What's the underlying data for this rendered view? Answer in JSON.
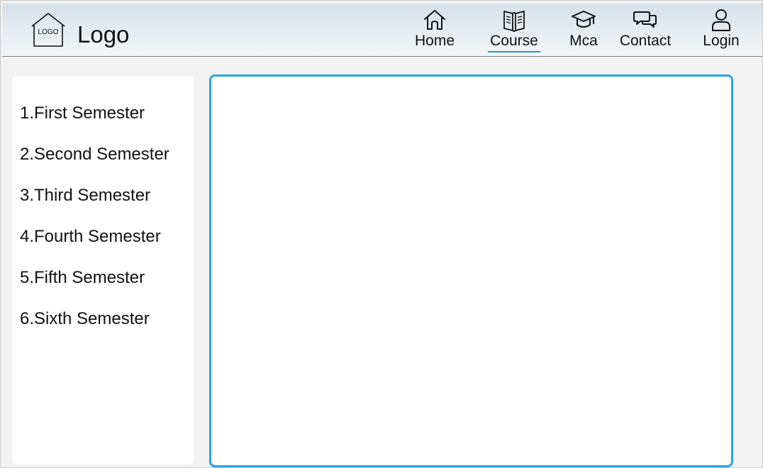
{
  "brand": {
    "logo_badge": "LOGO",
    "logo_text": "Logo"
  },
  "nav": [
    {
      "label": "Home",
      "icon": "home-icon",
      "active": false
    },
    {
      "label": "Course",
      "icon": "book-icon",
      "active": true
    },
    {
      "label": "Mca",
      "icon": "graduation-cap-icon",
      "active": false
    },
    {
      "label": "Contact",
      "icon": "chat-bubbles-icon",
      "active": false
    },
    {
      "label": "Login",
      "icon": "user-icon",
      "active": false
    }
  ],
  "sidebar": {
    "items": [
      {
        "label": "1.First Semester"
      },
      {
        "label": "2.Second Semester"
      },
      {
        "label": "3.Third Semester"
      },
      {
        "label": "4.Fourth Semester"
      },
      {
        "label": "5.Fifth Semester"
      },
      {
        "label": "6.Sixth Semester"
      }
    ]
  },
  "colors": {
    "accent": "#27a5e8",
    "header_top": "#d6e1e9",
    "header_bottom": "#f3f6f8",
    "page_background": "#f2f2f2"
  }
}
